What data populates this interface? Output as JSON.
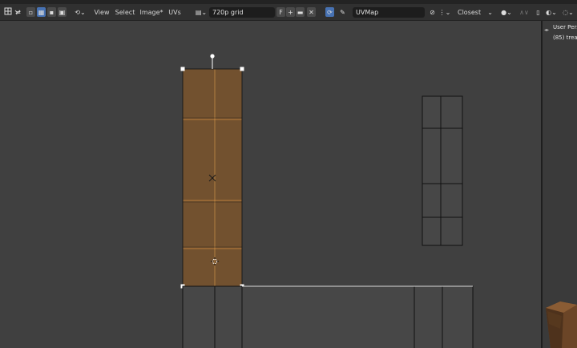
{
  "header": {
    "menu": {
      "view": "View",
      "select": "Select",
      "image": "Image*",
      "uvs": "UVs"
    },
    "image_name": "720p grid",
    "image_fake_user": "F",
    "uv_map": "UVMap",
    "snap_target": "Closest"
  },
  "right_panel": {
    "view_label": "User Pers",
    "object_label": "(85) trea"
  },
  "colors": {
    "selected_face": "#72512f",
    "grid_wire": "#111111",
    "viewport_bg": "#404040",
    "active_button": "#4772b3"
  },
  "icons": [
    "editor-type-icon",
    "sync-selection-icon",
    "vertex-mode-icon",
    "edge-mode-icon",
    "face-mode-icon",
    "island-mode-icon",
    "sticky-mode-icon",
    "image-browse-icon",
    "new-image-icon",
    "open-image-icon",
    "close-icon",
    "pin-icon",
    "image-pin-icon",
    "pivot-icon",
    "snap-icon",
    "proportional-icon",
    "overlay-icon",
    "shading-icon",
    "viewport-toggle-icon"
  ]
}
